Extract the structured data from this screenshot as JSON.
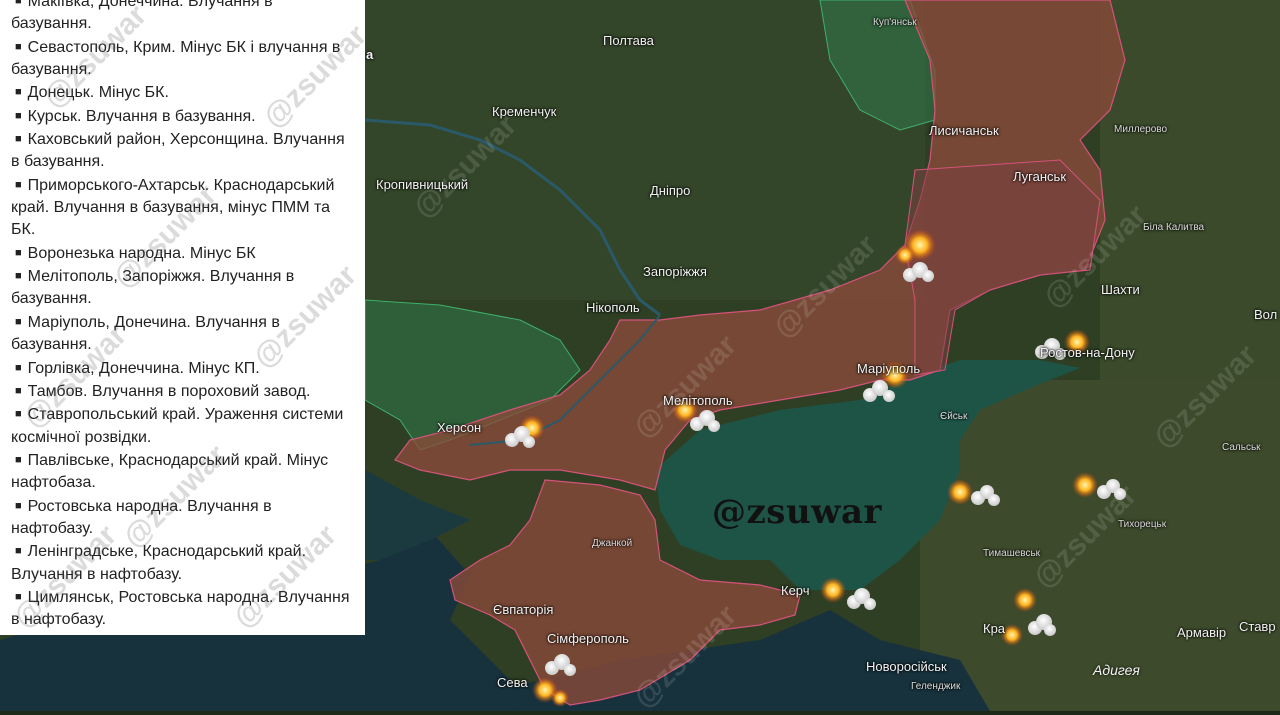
{
  "watermark": "@zsuwar",
  "brand": "@zsuwar",
  "strike_list": [
    "Макіївка, Донеччина. Влучання в базування.",
    "Севастополь, Крим. Мінус БК і влучання в базування.",
    "Донецьк. Мінус БК.",
    "Курськ. Влучання в базування.",
    "Каховський район, Херсонщина. Влучання в базування.",
    "Приморського-Ахтарськ. Краснодарський край. Влучання в базування, мінус ПММ та БК.",
    "Воронезька народна. Мінус БК",
    "Мелітополь, Запоріжжя. Влучання в базування.",
    "Маріуполь, Донечина. Влучання в базування.",
    "Горлівка, Донеччина. Мінус КП.",
    "Тамбов. Влучання в пороховий завод.",
    "Ставропольський край. Ураження системи космічної розвідки.",
    "Павлівське, Краснодарський край. Мінус нафтобаза.",
    "Ростовська народна. Влучання в нафтобазу.",
    "Ленінградське, Краснодарський край. Влучання в нафтобазу.",
    "Цимлянськ, Ростовська народна. Влучання в нафтобазу."
  ],
  "map": {
    "cities": {
      "poltava": "Полтава",
      "kupiansk": "Куп'янськ",
      "kremenchuk": "Кременчук",
      "lysychansk": "Лисичанськ",
      "millerovo": "Миллерово",
      "kropyvnytskyi": "Кропивницький",
      "dnipro": "Дніпро",
      "luhansk": "Луганськ",
      "bila_kalytva": "Біла Калитва",
      "zaporizhzhia": "Запоріжжя",
      "shakhty": "Шахти",
      "nikopol": "Нікополь",
      "rostov": "Ростов-на-Дону",
      "vol": "Вол",
      "mariupol": "Маріуполь",
      "kherson": "Херсон",
      "melitopol": "Мелітополь",
      "yeisk": "Єйськ",
      "salsk": "Сальськ",
      "tikhoretsk": "Тихорецьк",
      "dzhankoi": "Джанкой",
      "tymashevsk": "Тимашевськ",
      "yevpatoria": "Євпаторія",
      "kerch": "Керч",
      "armavir": "Армавір",
      "stavropol": "Ставр",
      "simferopol": "Сімферополь",
      "krasnodar": "Кра",
      "novorossiysk": "Новоросійськ",
      "adygea": "Адигея",
      "sevastopol": "Сева",
      "gelendzhik": "Геленджик",
      "partial_a": "а"
    }
  },
  "colors": {
    "occupied_fill": "#8a4a3a",
    "frontline": "#d4537a",
    "liberated_fill": "#2f7a4a",
    "sea": "#1f5a4a"
  }
}
